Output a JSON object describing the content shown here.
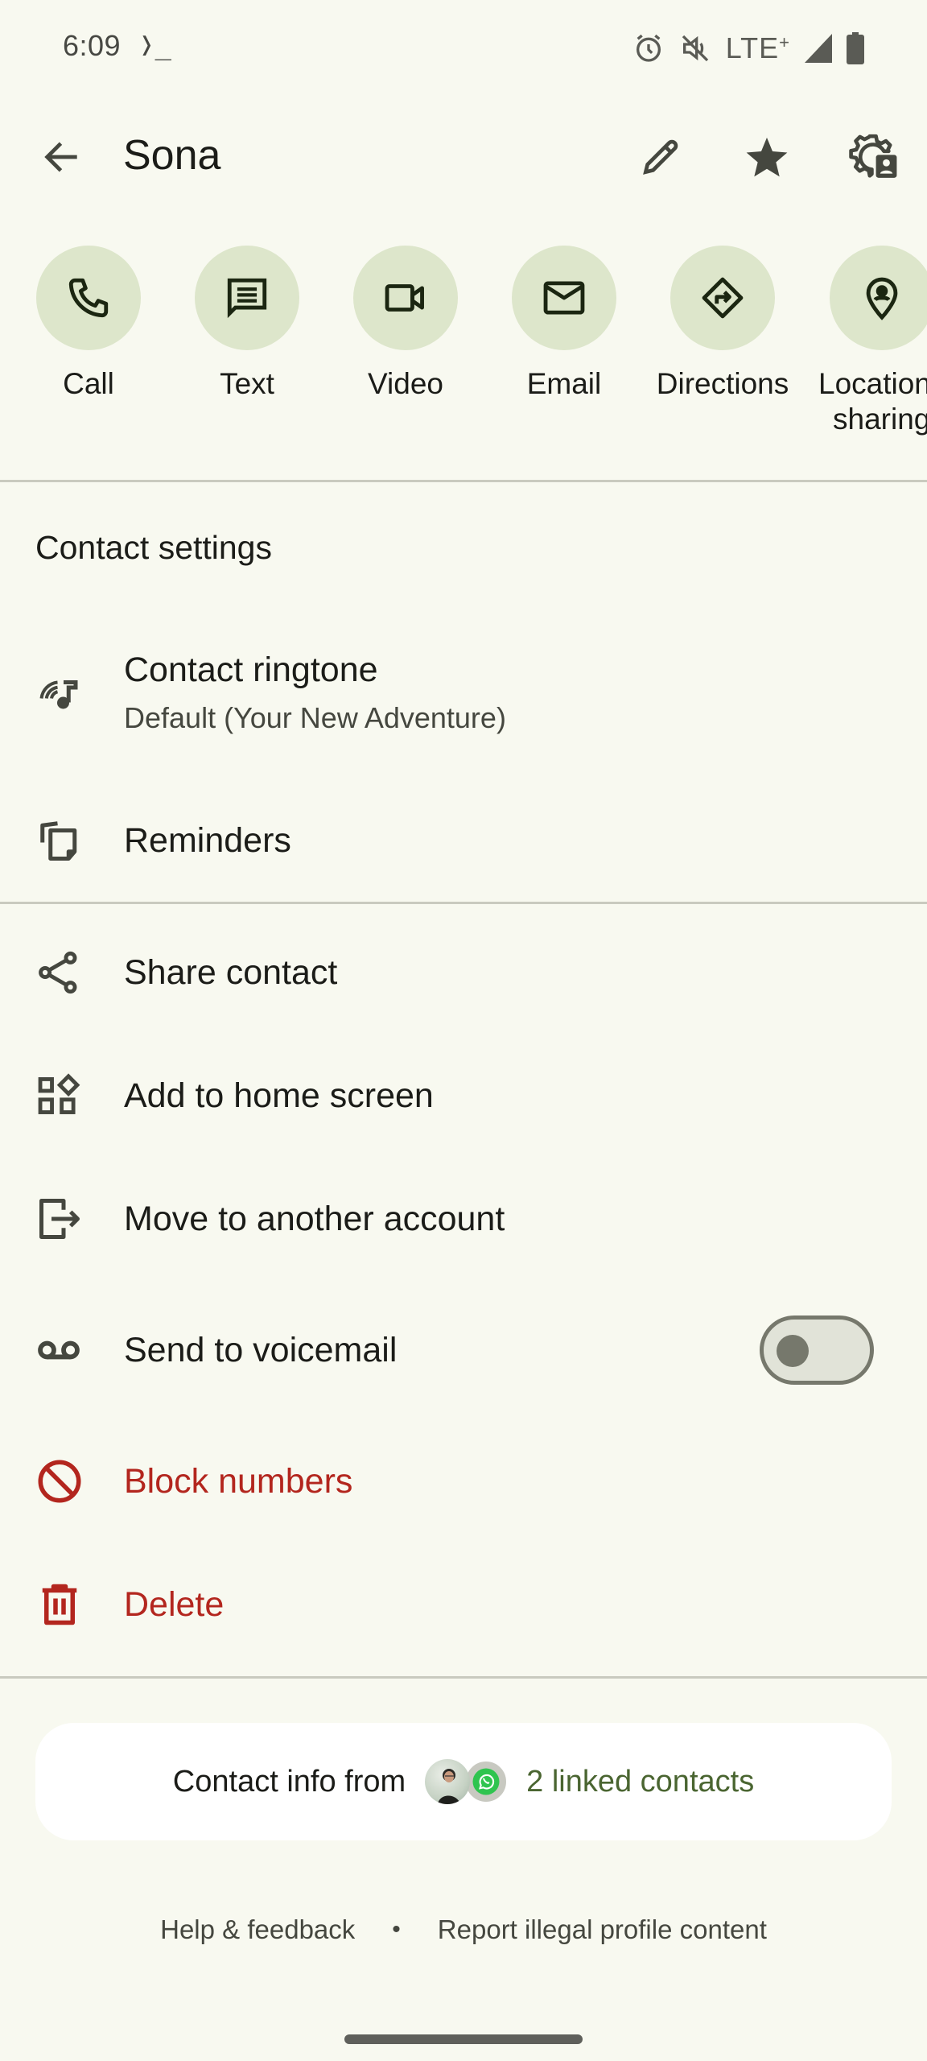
{
  "status_bar": {
    "time": "6:09",
    "terminal_glyph": "❭_",
    "network": "LTE",
    "network_suffix": "+",
    "icons": [
      "alarm-icon",
      "vibrate-off-icon",
      "signal-icon",
      "battery-icon"
    ]
  },
  "header": {
    "title": "Sona",
    "icons": [
      "back-arrow-icon",
      "edit-pencil-icon",
      "star-icon",
      "contact-settings-gear-icon"
    ]
  },
  "actions": [
    {
      "label": "Call",
      "icon": "phone-icon"
    },
    {
      "label": "Text",
      "icon": "message-icon"
    },
    {
      "label": "Video",
      "icon": "video-camera-icon"
    },
    {
      "label": "Email",
      "icon": "mail-icon"
    },
    {
      "label": "Directions",
      "icon": "directions-icon"
    },
    {
      "label": "Location sharing",
      "line1": "Location",
      "line2": "sharing",
      "icon": "location-person-icon"
    }
  ],
  "contact_settings": {
    "title": "Contact settings",
    "ringtone": {
      "label": "Contact ringtone",
      "value": "Default (Your New Adventure)"
    },
    "reminders": {
      "label": "Reminders"
    }
  },
  "more_actions": {
    "share": "Share contact",
    "add_home": "Add to home screen",
    "move_account": "Move to another account",
    "voicemail": {
      "label": "Send to voicemail",
      "enabled": false
    },
    "block": "Block numbers",
    "delete": "Delete"
  },
  "linked": {
    "prefix": "Contact info from",
    "link_text": "2 linked contacts",
    "sources": [
      "contact-photo",
      "whatsapp-icon"
    ]
  },
  "footer": {
    "help": "Help & feedback",
    "separator": "•",
    "report": "Report illegal profile content"
  },
  "colors": {
    "background": "#f8f9f0",
    "action_circle": "#dde6cb",
    "danger": "#b3261e",
    "link_green": "#4a6531"
  }
}
